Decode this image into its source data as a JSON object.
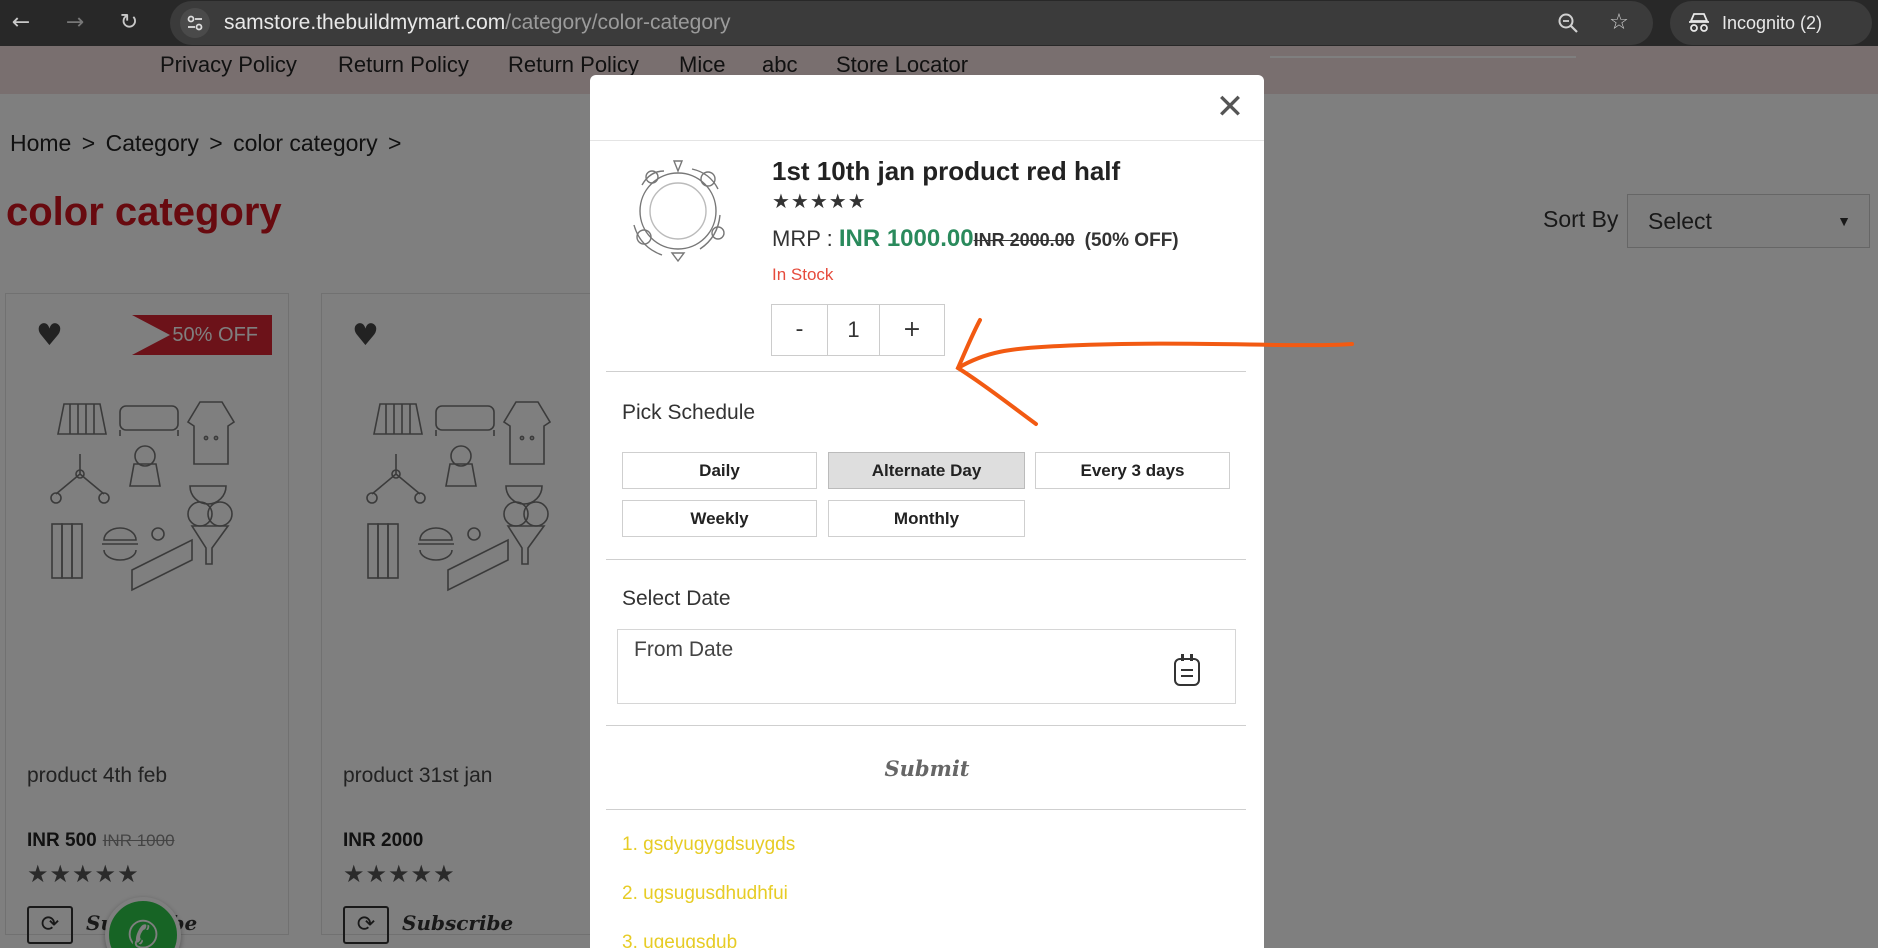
{
  "browser": {
    "url_domain": "samstore.thebuildmymart.com",
    "url_path": "/category/color-category",
    "incognito_label": "Incognito (2)"
  },
  "top_nav": {
    "links": [
      "Privacy Policy",
      "Return Policy",
      "Return Policy",
      "Mice",
      "abc",
      "Store Locator"
    ]
  },
  "breadcrumb": [
    "Home",
    ">",
    "Category",
    ">",
    "color category",
    ">"
  ],
  "page_title": "color category",
  "sort": {
    "label": "Sort By",
    "value": "Select"
  },
  "products": [
    {
      "name": "product 4th feb",
      "price": "INR 500",
      "old_price": "INR 1000",
      "badge": "50% OFF",
      "stars": "★★★★★",
      "subscribe": "Subscribe"
    },
    {
      "name": "product 31st jan",
      "price": "INR 2000",
      "old_price": "",
      "badge": "",
      "stars": "★★★★★",
      "subscribe": "Subscribe"
    }
  ],
  "modal": {
    "product_title": "1st 10th jan product red half",
    "stars": "★★★★★",
    "mrp_label": "MRP : ",
    "price": "INR 1000.00",
    "old_price": "INR 2000.00",
    "discount": "(50% OFF)",
    "stock": "In Stock",
    "qty_minus": "-",
    "qty_value": "1",
    "qty_plus": "+",
    "schedule_title": "Pick Schedule",
    "schedule_options": [
      "Daily",
      "Alternate Day",
      "Every 3 days",
      "Weekly",
      "Monthly"
    ],
    "selected_schedule": "Alternate Day",
    "date_title": "Select Date",
    "from_date_placeholder": "From Date",
    "submit_label": "Submit",
    "notes": [
      "1. gsdyugygdsuygds",
      "2. ugsugusdhudhfui",
      "3. ugeugsdub"
    ]
  },
  "colors": {
    "accent_red": "#d0141f",
    "price_green": "#2a8a5c",
    "stock_red": "#e64b3c",
    "note_yellow": "#e7cc25",
    "annotation_orange": "#f25a12"
  }
}
